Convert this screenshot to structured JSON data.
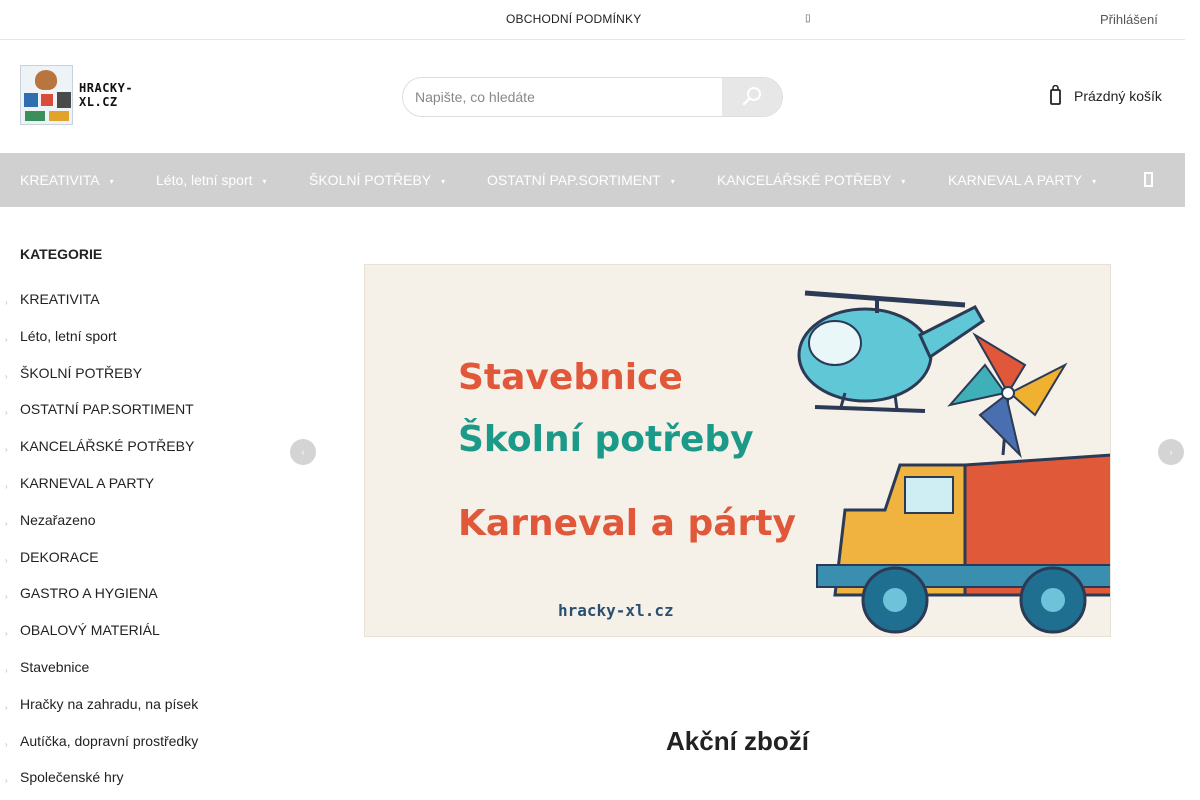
{
  "topbar": {
    "terms_link": "OBCHODNÍ PODMÍNKY",
    "menu_glyph": "▯",
    "login": "Přihlášení"
  },
  "header": {
    "logo_text": "HRACKY-XL.CZ",
    "search_placeholder": "Napište, co hledáte",
    "cart_label": "Prázdný košík"
  },
  "nav": {
    "items": [
      {
        "label": "KREATIVITA"
      },
      {
        "label": "Léto, letní sport"
      },
      {
        "label": "ŠKOLNÍ POTŘEBY"
      },
      {
        "label": "OSTATNÍ PAP.SORTIMENT"
      },
      {
        "label": "KANCELÁŘSKÉ POTŘEBY"
      },
      {
        "label": "KARNEVAL A PARTY"
      }
    ],
    "caret": "▾"
  },
  "sidebar": {
    "title": "KATEGORIE",
    "items": [
      {
        "label": "KREATIVITA"
      },
      {
        "label": "Léto, letní sport"
      },
      {
        "label": "ŠKOLNÍ POTŘEBY"
      },
      {
        "label": "OSTATNÍ PAP.SORTIMENT"
      },
      {
        "label": "KANCELÁŘSKÉ POTŘEBY"
      },
      {
        "label": "KARNEVAL A PARTY"
      },
      {
        "label": "Nezařazeno"
      },
      {
        "label": "DEKORACE"
      },
      {
        "label": "GASTRO A HYGIENA"
      },
      {
        "label": "OBALOVÝ MATERIÁL"
      },
      {
        "label": "Stavebnice"
      },
      {
        "label": "Hračky na zahradu, na písek"
      },
      {
        "label": "Autíčka, dopravní prostředky"
      },
      {
        "label": "Společenské hry"
      }
    ],
    "arrow": "›"
  },
  "banner": {
    "line1": "Stavebnice",
    "line2": "Školní potřeby",
    "line3": "Karneval a párty",
    "url": "hracky-xl.cz"
  },
  "carousel": {
    "prev_glyph": "‹",
    "next_glyph": "›"
  },
  "main": {
    "section_title": "Akční zboží"
  },
  "colors": {
    "nav_bg": "#d0d0d0",
    "search_btn_bg": "#e7e7e7",
    "banner_red": "#e0573a",
    "banner_teal": "#1b9a8a"
  }
}
